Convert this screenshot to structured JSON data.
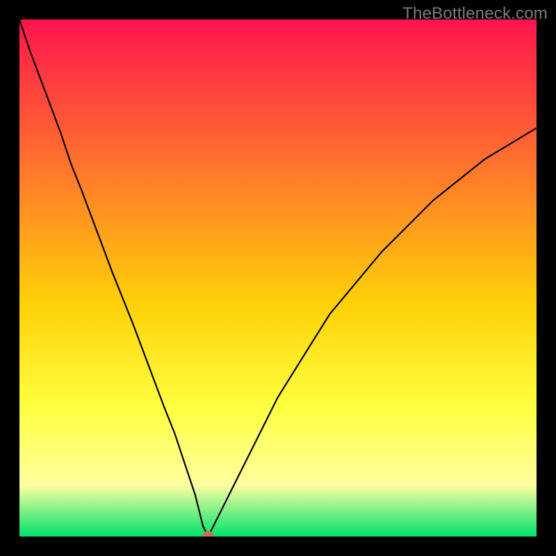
{
  "watermark": "TheBottleneck.com",
  "colors": {
    "border": "#000000",
    "gradient_top": "#ff144e",
    "gradient_mid1": "#ff7a2a",
    "gradient_mid2": "#ffd108",
    "gradient_mid3": "#ffff40",
    "gradient_mid4": "#ffffa0",
    "gradient_bottom": "#00e26e",
    "curve": "#000000",
    "marker_fill": "#d56a5a",
    "marker_stroke": "#d56a5a"
  },
  "chart_data": {
    "type": "line",
    "title": "",
    "xlabel": "",
    "ylabel": "",
    "xlim": [
      0,
      100
    ],
    "ylim": [
      0,
      100
    ],
    "x": [
      0,
      2,
      5,
      8,
      10,
      12,
      15,
      18,
      20,
      22,
      25,
      28,
      30,
      31,
      32,
      33,
      34,
      34.5,
      35,
      35.5,
      36,
      36.5,
      37,
      38,
      40,
      42,
      45,
      48,
      50,
      55,
      60,
      65,
      70,
      75,
      80,
      85,
      90,
      95,
      100
    ],
    "values": [
      100,
      94,
      86,
      78,
      72,
      67,
      59,
      51,
      46,
      41,
      33,
      25,
      20,
      17,
      14,
      11,
      8,
      6,
      4,
      2,
      1,
      0,
      1,
      3,
      7,
      11,
      17,
      23,
      27,
      35,
      43,
      49,
      55,
      60,
      65,
      69,
      73,
      76,
      79
    ],
    "marker": {
      "x": 36.5,
      "y": 0
    },
    "note": "percent-scale; V-shaped bottleneck curve; minimum at approx x=36.5"
  }
}
